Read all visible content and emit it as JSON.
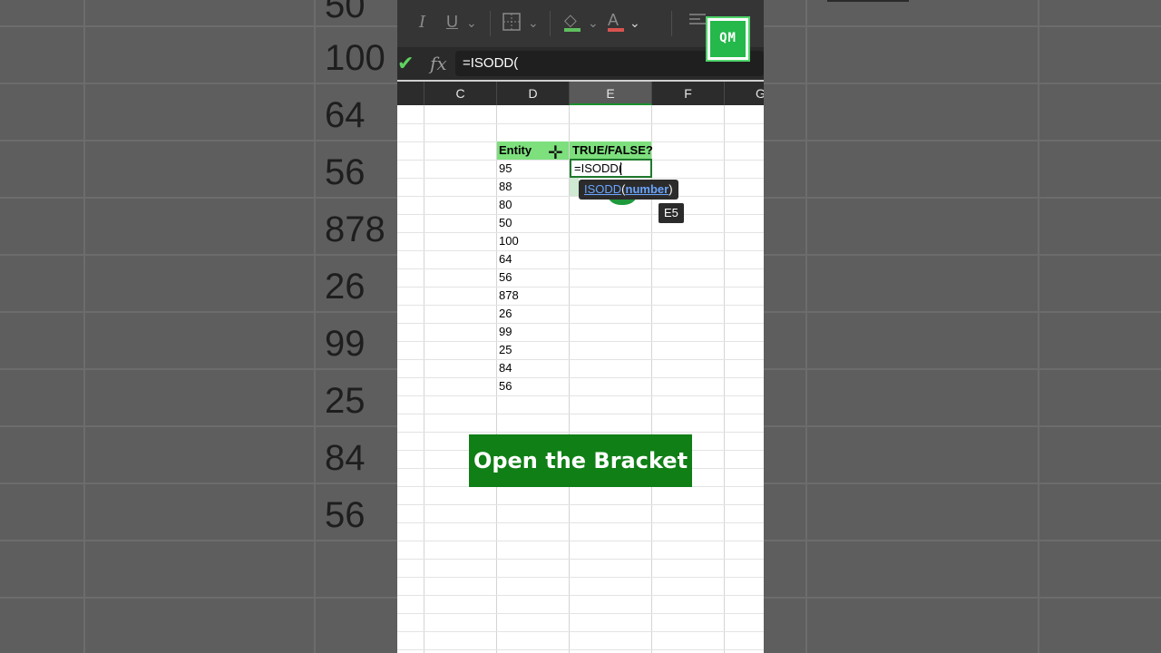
{
  "background": {
    "numbers": [
      "50",
      "100",
      "64",
      "56",
      "878",
      "26",
      "99",
      "25",
      "84",
      "56"
    ]
  },
  "toolbar": {
    "italic_icon": "I",
    "underline_icon": "U",
    "fill_icon": "◇",
    "font_color_icon": "A",
    "chevron": "⌄"
  },
  "formula_bar": {
    "check": "✔",
    "fx": "fx",
    "value": "=ISODD("
  },
  "columns": [
    "C",
    "D",
    "E",
    "F",
    "G"
  ],
  "table": {
    "header_d": "Entity",
    "header_e": "TRUE/FALSE?",
    "values": [
      "95",
      "88",
      "80",
      "50",
      "100",
      "64",
      "56",
      "878",
      "26",
      "99",
      "25",
      "84",
      "56"
    ]
  },
  "editing_cell": {
    "text": "=ISODD(",
    "cell_ref": "E5"
  },
  "tooltip": {
    "function": "ISODD",
    "open_paren": "(",
    "argument": "number",
    "close_paren": ")"
  },
  "caption": "Open the Bracket",
  "logo": {
    "text": "QM",
    "color": "#25b84b"
  },
  "colors": {
    "header_fill": "#7de07d",
    "caption_bg": "#107f16",
    "active_border": "#1f7a2c"
  }
}
